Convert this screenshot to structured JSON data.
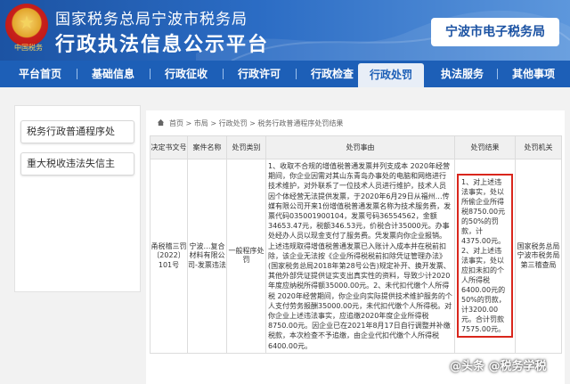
{
  "header": {
    "title": "国家税务总局宁波市税务局",
    "subtitle": "行政执法信息公示平台",
    "emblem_label": "中国税务",
    "etax_button": "宁波市电子税务局"
  },
  "nav": {
    "items": [
      {
        "label": "平台首页",
        "active": false
      },
      {
        "label": "基础信息",
        "active": false
      },
      {
        "label": "行政征收",
        "active": false
      },
      {
        "label": "行政许可",
        "active": false
      },
      {
        "label": "行政检查",
        "active": false
      },
      {
        "label": "行政处罚",
        "active": true
      },
      {
        "label": "执法服务",
        "active": false
      },
      {
        "label": "其他事项",
        "active": false
      }
    ]
  },
  "sidebar": {
    "items": [
      {
        "label": "税务行政普通程序处"
      },
      {
        "label": "重大税收违法失信主"
      }
    ]
  },
  "breadcrumb": "首页 > 市局 > 行政处罚 > 税务行政普通程序处罚结果",
  "table": {
    "headers": [
      "决定书文号",
      "案件名称",
      "处罚类别",
      "处罚事由",
      "处罚结果",
      "处罚机关"
    ],
    "row": {
      "doc_no": "甬税稽三罚〔2022〕101号",
      "case_name": "宁波…复合材料有限公司-发票违法",
      "category": "一般程序处罚",
      "reason": "1、收取不合规的增值税普通发票并列支成本 2020年经营期间，你企业因需对其山东青岛办事处的电脑和网络进行技术维护，对外联系了一位技术人员进行维护，技术人员因个体经营无法提供发票，于2020年6月29日从福州…传媒有限公司开来1份增值税普通发票名称为技术服务费，发票代码035001900104，发票号码36554562，金额34653.47元，税额346.53元，价税合计35000元。办事处经办人员以现金支付了服务费。凭发票向你企业报销。上述违规取得增值税普通发票已入账计入成本并在税前扣除，该企业无法按《企业所得税税前扣除凭证管理办法》(国家税务总局2018年第28号公告)规定补开、换开发票、其他外部凭证提供证实支出真实性的资料，导致少计2020年度应纳税所得额35000.00元。2、未代扣代缴个人所得税 2020年经营期间，你企业向实际提供技术维护服务的个人支付劳务报酬35000.00元，未代扣代缴个人所得税。对你企业上述违法事实，应追缴2020年度企业所得税8750.00元。因企业已在2021年8月17日自行调整并补缴税款，本次检查不予追缴，由企业代扣代缴个人所得税6400.00元。",
      "result": "1、对上述违法事实，处以所偷企业所得税8750.00元的50%的罚款，计4375.00元。2、对上述违法事实，处以应扣未扣的个人所得税6400.00元的50%的罚款，计3200.00元。合计罚款7575.00元。",
      "authority": "国家税务总局宁波市税务局第三稽查局"
    }
  },
  "watermark": "@头条 @税务学税"
}
